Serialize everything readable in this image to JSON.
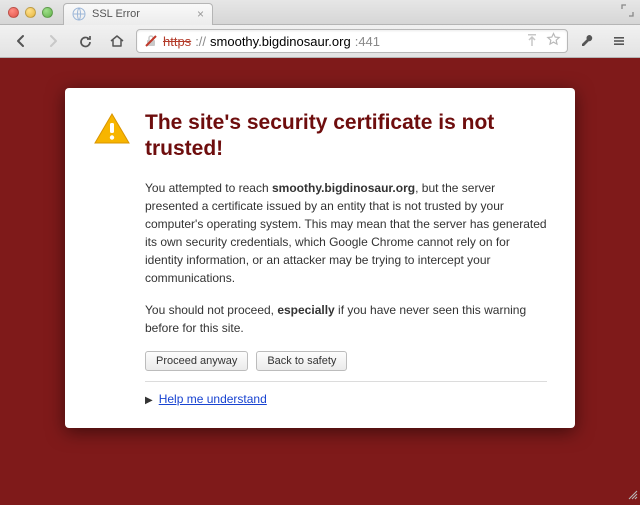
{
  "window": {
    "tab_title": "SSL Error"
  },
  "toolbar": {
    "url_scheme": "https",
    "url_sep": "://",
    "url_host": "smoothy.bigdinosaur.org",
    "url_port": ":441"
  },
  "ssl": {
    "title": "The site's security certificate is not trusted!",
    "para1_a": "You attempted to reach ",
    "para1_host": "smoothy.bigdinosaur.org",
    "para1_b": ", but the server presented a certificate issued by an entity that is not trusted by your computer's operating system. This may mean that the server has generated its own security credentials, which Google Chrome cannot rely on for identity information, or an attacker may be trying to intercept your communications.",
    "para2_a": "You should not proceed, ",
    "para2_b": "especially",
    "para2_c": " if you have never seen this warning before for this site.",
    "proceed_label": "Proceed anyway",
    "back_label": "Back to safety",
    "help_label": "Help me understand"
  },
  "colors": {
    "page_bg": "#7f1a1a",
    "title_color": "#6e0d0d"
  }
}
